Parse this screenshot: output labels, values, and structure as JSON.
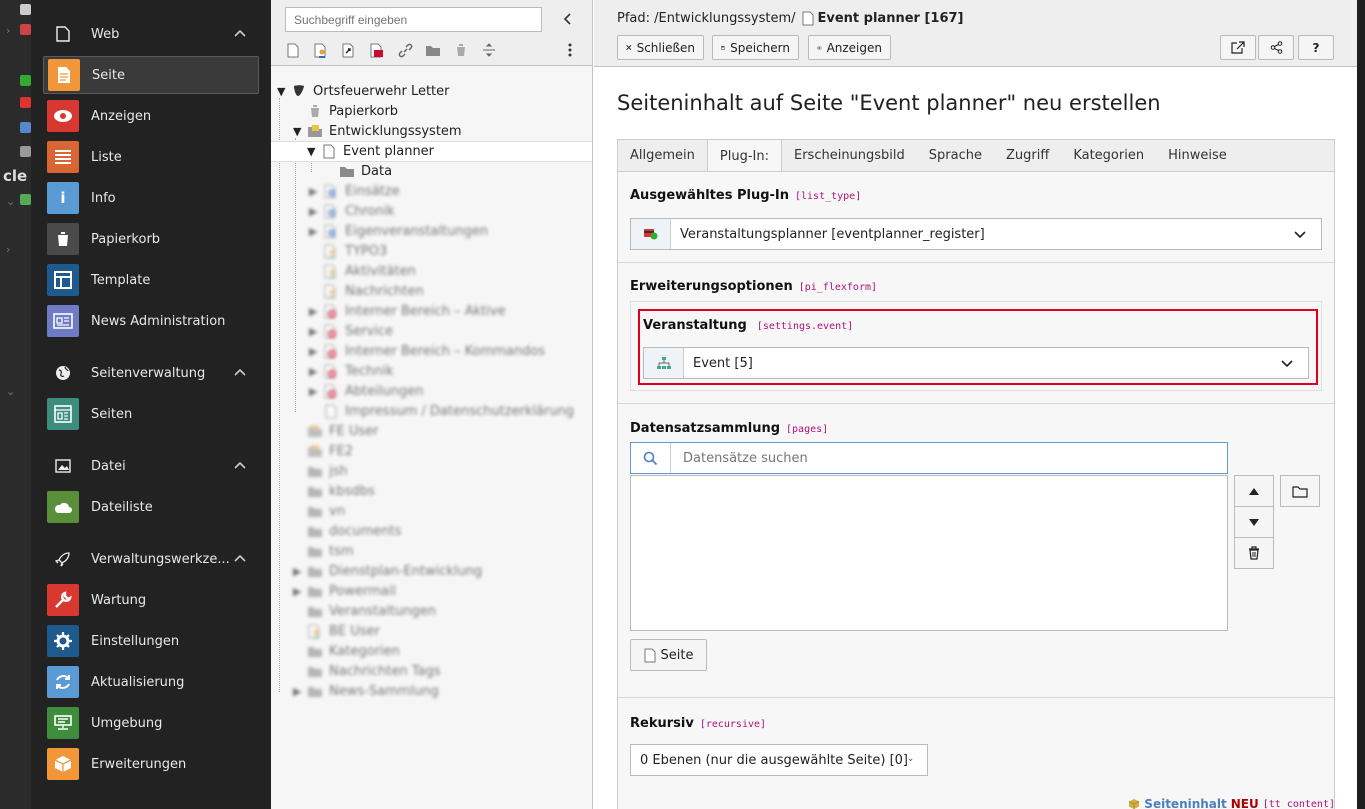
{
  "left_strip": {
    "text": "cle"
  },
  "module_menu": {
    "groups": [
      {
        "label": "Web",
        "icon": "file-icon"
      },
      {
        "label": "Seitenverwaltung",
        "icon": "globe-icon"
      },
      {
        "label": "Datei",
        "icon": "image-icon"
      },
      {
        "label": "Verwaltungswerkze...",
        "icon": "rocket-icon"
      }
    ],
    "modules": [
      {
        "label": "Seite",
        "icon": "page-icon",
        "color": "#f29739",
        "active": true
      },
      {
        "label": "Anzeigen",
        "icon": "eye-icon",
        "color": "#d8382f"
      },
      {
        "label": "Liste",
        "icon": "list-icon",
        "color": "#d96532"
      },
      {
        "label": "Info",
        "icon": "info-icon",
        "color": "#5b9bd5"
      },
      {
        "label": "Papierkorb",
        "icon": "trash-icon",
        "color": "#4a4a4a"
      },
      {
        "label": "Template",
        "icon": "template-icon",
        "color": "#1e5a8e"
      },
      {
        "label": "News Administration",
        "icon": "newspaper-icon",
        "color": "#6e7cc6"
      },
      {
        "label": "Seiten",
        "icon": "seiten-icon",
        "color": "#3d8d7e"
      },
      {
        "label": "Dateiliste",
        "icon": "cloud-icon",
        "color": "#5a8f3a"
      },
      {
        "label": "Wartung",
        "icon": "wrench-icon",
        "color": "#d8382f"
      },
      {
        "label": "Einstellungen",
        "icon": "gear-icon",
        "color": "#1e5a8e"
      },
      {
        "label": "Aktualisierung",
        "icon": "refresh-icon",
        "color": "#5b9bd5"
      },
      {
        "label": "Umgebung",
        "icon": "server-icon",
        "color": "#3d8d3d"
      },
      {
        "label": "Erweiterungen",
        "icon": "box-icon",
        "color": "#f29739"
      }
    ]
  },
  "page_tree": {
    "search_placeholder": "Suchbegriff eingeben",
    "nodes": [
      {
        "label": "Ortsfeuerwehr Letter",
        "icon": "typo3-icon",
        "expanded": true
      },
      {
        "label": "Papierkorb",
        "icon": "trash-icon"
      },
      {
        "label": "Entwicklungssystem",
        "icon": "folder-open-icon",
        "expanded": true
      },
      {
        "label": "Event planner",
        "icon": "page-icon",
        "expanded": true,
        "selected": true
      },
      {
        "label": "Data",
        "icon": "folder-icon"
      },
      {
        "label": "Einsätze",
        "icon": "shortcut-icon"
      },
      {
        "label": "Chronik",
        "icon": "shortcut-icon"
      },
      {
        "label": "Eigenveranstaltungen",
        "icon": "shortcut-icon"
      },
      {
        "label": "TYPO3",
        "icon": "user-page-icon"
      },
      {
        "label": "Aktivitäten",
        "icon": "user-page-icon"
      },
      {
        "label": "Nachrichten",
        "icon": "user-page-icon"
      },
      {
        "label": "Interner Bereich – Aktive",
        "icon": "restricted-icon"
      },
      {
        "label": "Service",
        "icon": "restricted-icon"
      },
      {
        "label": "Interner Bereich – Kommandos",
        "icon": "restricted-icon"
      },
      {
        "label": "Technik",
        "icon": "restricted-icon"
      },
      {
        "label": "Abteilungen",
        "icon": "restricted-icon"
      },
      {
        "label": "Impressum / Datenschutzerklärung",
        "icon": "page-icon"
      },
      {
        "label": "FE User",
        "icon": "folder-user-icon"
      },
      {
        "label": "FE2",
        "icon": "folder-user-icon"
      },
      {
        "label": "jsh",
        "icon": "folder-icon"
      },
      {
        "label": "kbsdbs",
        "icon": "folder-icon"
      },
      {
        "label": "vn",
        "icon": "folder-icon"
      },
      {
        "label": "documents",
        "icon": "folder-icon"
      },
      {
        "label": "tsm",
        "icon": "folder-icon"
      },
      {
        "label": "Dienstplan-Entwicklung",
        "icon": "folder-icon"
      },
      {
        "label": "Powermail",
        "icon": "folder-icon"
      },
      {
        "label": "Veranstaltungen",
        "icon": "folder-icon"
      },
      {
        "label": "BE User",
        "icon": "user-page-icon"
      },
      {
        "label": "Kategorien",
        "icon": "folder-icon"
      },
      {
        "label": "Nachrichten Tags",
        "icon": "folder-icon"
      },
      {
        "label": "News-Sammlung",
        "icon": "folder-icon"
      }
    ]
  },
  "doc_header": {
    "path_label": "Pfad: /Entwicklungssystem/",
    "page_title": "Event planner [167]",
    "close_label": "Schließen",
    "save_label": "Speichern",
    "view_label": "Anzeigen",
    "help_label": "?"
  },
  "form": {
    "title": "Seiteninhalt auf Seite \"Event planner\" neu erstellen",
    "tabs": [
      "Allgemein",
      "Plug-In:",
      "Erscheinungsbild",
      "Sprache",
      "Zugriff",
      "Kategorien",
      "Hinweise"
    ],
    "active_tab": "Plug-In:",
    "plugin": {
      "label": "Ausgewähltes Plug-In",
      "code": "[list_type]",
      "value": "Veranstaltungsplanner [eventplanner_register]"
    },
    "ext_options": {
      "label": "Erweiterungsoptionen",
      "code": "[pi_flexform]"
    },
    "event": {
      "label": "Veranstaltung",
      "code": "[settings.event]",
      "value": "Event [5]"
    },
    "records": {
      "label": "Datensatzsammlung",
      "code": "[pages]",
      "search_placeholder": "Datensätze suchen",
      "page_button": "Seite"
    },
    "recursive": {
      "label": "Rekursiv",
      "code": "[recursive]",
      "value": "0 Ebenen (nur die ausgewählte Seite) [0]"
    },
    "footer": {
      "table": "Seiteninhalt",
      "status": "NEU",
      "code": "[tt_content]"
    }
  }
}
